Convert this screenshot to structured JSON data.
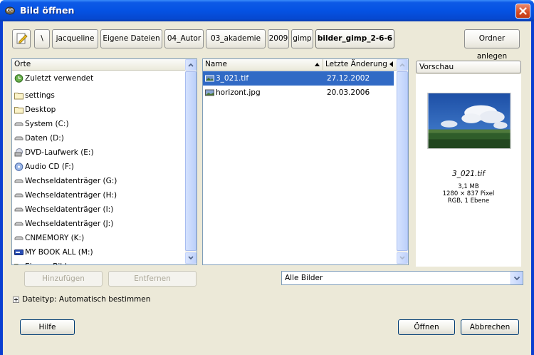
{
  "window": {
    "title": "Bild öffnen"
  },
  "pathbar": {
    "crumbs": [
      {
        "label": "\\"
      },
      {
        "label": "jacqueline"
      },
      {
        "label": "Eigene Dateien"
      },
      {
        "label": "04_Autor"
      },
      {
        "label": "03_akademie"
      },
      {
        "label": "2009"
      },
      {
        "label": "gimp"
      },
      {
        "label": "bilder_gimp_2-6-6"
      }
    ],
    "new_folder_label": "Ordner anlegen"
  },
  "places": {
    "header": "Orte",
    "items": [
      {
        "label": "Zuletzt verwendet",
        "icon": "recent-icon"
      },
      {
        "label": "settings",
        "icon": "folder-icon"
      },
      {
        "label": "Desktop",
        "icon": "folder-icon"
      },
      {
        "label": "System (C:)",
        "icon": "drive-icon"
      },
      {
        "label": "Daten (D:)",
        "icon": "drive-icon"
      },
      {
        "label": "DVD-Laufwerk (E:)",
        "icon": "dvd-icon"
      },
      {
        "label": "Audio CD (F:)",
        "icon": "cd-icon"
      },
      {
        "label": "Wechseldatenträger (G:)",
        "icon": "drive-icon"
      },
      {
        "label": "Wechseldatenträger (H:)",
        "icon": "drive-icon"
      },
      {
        "label": "Wechseldatenträger (I:)",
        "icon": "drive-icon"
      },
      {
        "label": "Wechseldatenträger (J:)",
        "icon": "drive-icon"
      },
      {
        "label": "CNMEMORY (K:)",
        "icon": "drive-icon"
      },
      {
        "label": "MY BOOK ALL (M:)",
        "icon": "external-drive-icon"
      },
      {
        "label": "Eigene Bilder",
        "icon": "folder-icon"
      }
    ],
    "add_label": "Hinzufügen",
    "remove_label": "Entfernen"
  },
  "files": {
    "col_name": "Name",
    "col_modified": "Letzte Änderung",
    "rows": [
      {
        "name": "3_021.tif",
        "modified": "27.12.2002",
        "selected": true
      },
      {
        "name": "horizont.jpg",
        "modified": "20.03.2006",
        "selected": false
      }
    ]
  },
  "filter": {
    "value": "Alle Bilder"
  },
  "preview": {
    "header": "Vorschau",
    "filename": "3_021.tif",
    "size": "3,1 MB",
    "dimensions": "1280 × 837 Pixel",
    "mode": "RGB, 1 Ebene"
  },
  "filetype": {
    "label": "Dateityp: Automatisch bestimmen"
  },
  "buttons": {
    "help": "Hilfe",
    "open": "Öffnen",
    "cancel": "Abbrechen"
  },
  "colors": {
    "titlebar": "#0552e3",
    "selection": "#316ac5",
    "dialog_bg": "#ece9d8"
  }
}
